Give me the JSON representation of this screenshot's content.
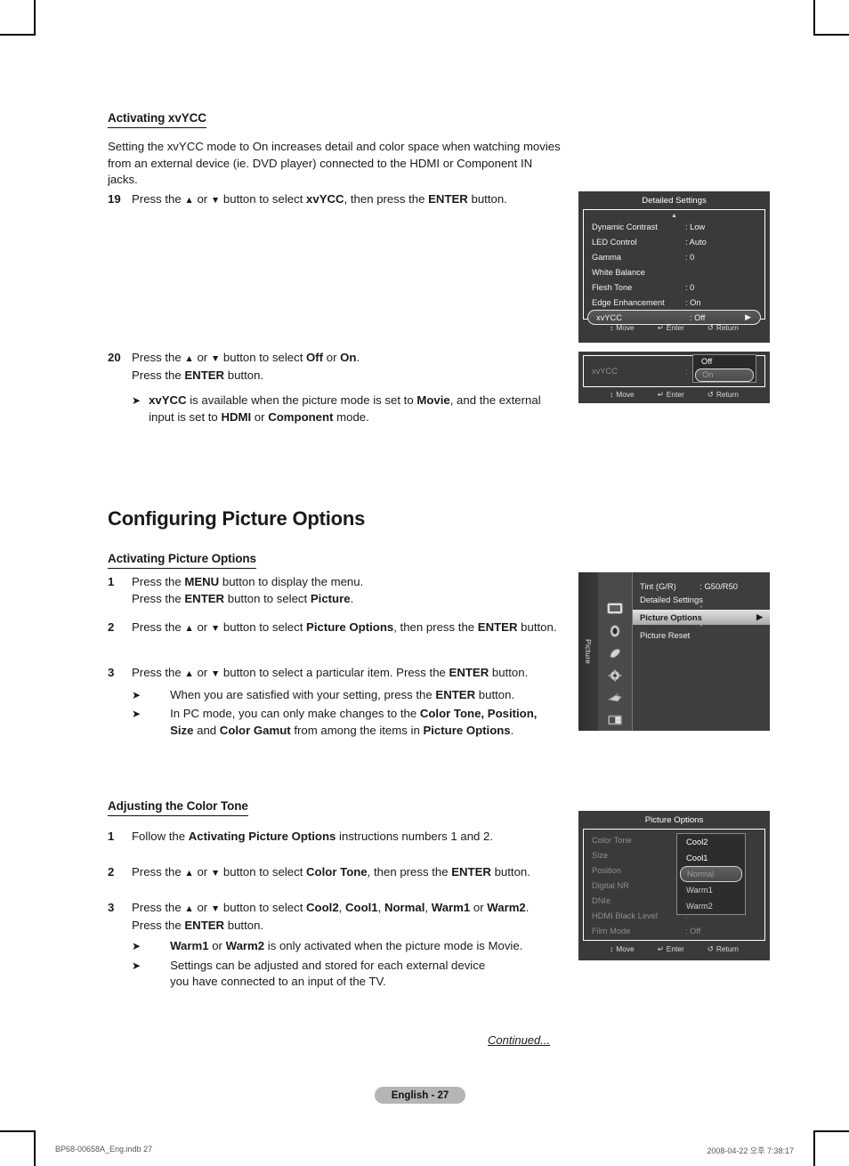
{
  "section_xvycc": {
    "heading": "Activating xvYCC",
    "intro": "Setting the xvYCC mode to On increases detail and color space when watching movies from an external device (ie. DVD player) connected to the HDMI or Component IN jacks.",
    "step19_num": "19",
    "step19_a": "Press the ",
    "step19_up": "▲",
    "step19_or": " or ",
    "step19_down": "▼",
    "step19_b": " button to select ",
    "step19_bold1": "xvYCC",
    "step19_c": ", then press the ",
    "step19_bold2": "ENTER",
    "step19_d": " button.",
    "step20_num": "20",
    "step20_a": "Press the ",
    "step20_b": " button to select ",
    "step20_bold1": "Off",
    "step20_c": " or ",
    "step20_bold2": "On",
    "step20_d": ".",
    "step20_line2_a": "Press the ",
    "step20_line2_bold": "ENTER",
    "step20_line2_b": " button.",
    "note_bold1": "xvYCC",
    "note_a": " is available when the picture mode is set to ",
    "note_bold2": "Movie",
    "note_b": ", and the external input is set to ",
    "note_bold3": "HDMI",
    "note_c": " or ",
    "note_bold4": "Component",
    "note_d": " mode."
  },
  "section_picture_options": {
    "title": "Configuring Picture Options",
    "heading": "Activating Picture Options",
    "step1_num": "1",
    "step1_l1_a": "Press the ",
    "step1_l1_bold": "MENU",
    "step1_l1_b": " button to display the menu.",
    "step1_l2_a": "Press the ",
    "step1_l2_bold1": "ENTER",
    "step1_l2_b": " button to select ",
    "step1_l2_bold2": "Picture",
    "step1_l2_c": ".",
    "step2_num": "2",
    "step2_a": "Press the ",
    "step2_b": " button to select ",
    "step2_bold1": "Picture Options",
    "step2_c": ", then press the ",
    "step2_bold2": "ENTER",
    "step2_d": " button.",
    "step3_num": "3",
    "step3_a": "Press the ",
    "step3_b": " button to select a particular item. Press the ",
    "step3_bold": "ENTER",
    "step3_c": " button.",
    "bullet1_a": "When you are satisfied with your setting, press the ",
    "bullet1_bold": "ENTER",
    "bullet1_b": " button.",
    "bullet2_a": "In PC mode, you can only make changes to the ",
    "bullet2_bold1": "Color Tone, Position, Size",
    "bullet2_b": " and ",
    "bullet2_bold2": "Color Gamut",
    "bullet2_c": " from among the items in ",
    "bullet2_bold3": "Picture Options",
    "bullet2_d": "."
  },
  "section_color_tone": {
    "heading": "Adjusting the Color Tone",
    "step1_num": "1",
    "step1_a": "Follow the ",
    "step1_bold": "Activating Picture Options",
    "step1_b": " instructions numbers 1 and 2.",
    "step2_num": "2",
    "step2_a": "Press the ",
    "step2_b": " button to select ",
    "step2_bold1": "Color Tone",
    "step2_c": ", then press the ",
    "step2_bold2": "ENTER",
    "step2_d": " button.",
    "step3_num": "3",
    "step3_a": "Press the ",
    "step3_b": " button to select ",
    "step3_bold1": "Cool2",
    "step3_sep1": ", ",
    "step3_bold2": "Cool1",
    "step3_sep2": ", ",
    "step3_bold3": "Normal",
    "step3_sep3": ", ",
    "step3_bold4": "Warm1",
    "step3_sep4": " or ",
    "step3_bold5": "Warm2",
    "step3_c": ".",
    "step3_l2_a": "Press the ",
    "step3_l2_bold": "ENTER",
    "step3_l2_b": " button.",
    "bullet1_bold1": "Warm1",
    "bullet1_a": " or ",
    "bullet1_bold2": "Warm2",
    "bullet1_b": " is only activated when the picture mode is Movie.",
    "bullet2_l1": "Settings can be adjusted and stored for each external device",
    "bullet2_l2": "you have connected to an input of the TV."
  },
  "osd_detailed_settings": {
    "title": "Detailed Settings",
    "rows": [
      {
        "label": "Dynamic Contrast",
        "value": ": Low"
      },
      {
        "label": "LED Control",
        "value": ": Auto"
      },
      {
        "label": "Gamma",
        "value": ": 0"
      },
      {
        "label": "White Balance",
        "value": ""
      },
      {
        "label": "Flesh Tone",
        "value": ": 0"
      },
      {
        "label": "Edge Enhancement",
        "value": ": On"
      },
      {
        "label": "xvYCC",
        "value": ": Off"
      }
    ],
    "selected_index": 6,
    "caret": "▶",
    "scroll_up": "▲",
    "footer": [
      {
        "icon": "↕",
        "label": "Move"
      },
      {
        "icon": "↵",
        "label": "Enter"
      },
      {
        "icon": "↺",
        "label": "Return"
      }
    ]
  },
  "osd_xvycc_popup": {
    "label": "xvYCC",
    "colon": ":",
    "options": [
      {
        "text": "Off",
        "highlighted": false
      },
      {
        "text": "On",
        "highlighted": true
      }
    ],
    "footer": [
      {
        "icon": "↕",
        "label": "Move"
      },
      {
        "icon": "↵",
        "label": "Enter"
      },
      {
        "icon": "↺",
        "label": "Return"
      }
    ]
  },
  "osd_picture_menu": {
    "rail_label": "Picture",
    "icons": [
      "tv-picture-icon",
      "sound-icon",
      "channel-icon",
      "setup-gear-icon",
      "input-icon",
      "support-icon"
    ],
    "selected_icon_index": 0,
    "rows": [
      {
        "label": "Tint (G/R)",
        "value": ": G50/R50",
        "selected": false
      },
      {
        "label": "Detailed Settings",
        "value": "",
        "selected": false
      },
      {
        "label": "Picture Options",
        "value": "",
        "selected": true
      },
      {
        "label": "Picture Reset",
        "value": "",
        "selected": false
      }
    ],
    "caret": "▶"
  },
  "osd_picture_options": {
    "title": "Picture Options",
    "rows": [
      {
        "label": "Color Tone",
        "value": ":"
      },
      {
        "label": "Size",
        "value": ":"
      },
      {
        "label": "Position",
        "value": ":"
      },
      {
        "label": "Digital NR",
        "value": ":"
      },
      {
        "label": "DNIe",
        "value": ":"
      },
      {
        "label": "HDMI Black Level",
        "value": ":"
      },
      {
        "label": "Film Mode",
        "value": ": Off"
      }
    ],
    "color_tone_options": [
      {
        "text": "Cool2",
        "highlighted": false,
        "dim": false
      },
      {
        "text": "Cool1",
        "highlighted": false,
        "dim": false
      },
      {
        "text": "Normal",
        "highlighted": true,
        "dim": false
      },
      {
        "text": "Warm1",
        "highlighted": false,
        "dim": true
      },
      {
        "text": "Warm2",
        "highlighted": false,
        "dim": true
      }
    ],
    "footer": [
      {
        "icon": "↕",
        "label": "Move"
      },
      {
        "icon": "↵",
        "label": "Enter"
      },
      {
        "icon": "↺",
        "label": "Return"
      }
    ]
  },
  "footer": {
    "continued": "Continued...",
    "page_label": "English - 27",
    "file_name": "BP68-00658A_Eng.indb   27",
    "timestamp": "2008-04-22   오후 7:38:17"
  }
}
